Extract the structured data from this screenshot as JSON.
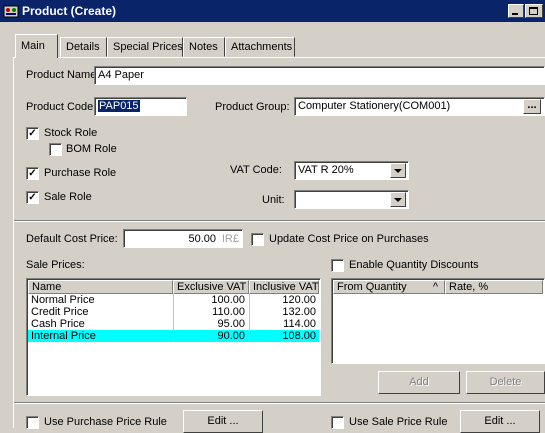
{
  "window": {
    "title": "Product (Create)",
    "icon": "app-icon"
  },
  "tabs": [
    {
      "label": "Main"
    },
    {
      "label": "Details"
    },
    {
      "label": "Special Prices"
    },
    {
      "label": "Notes"
    },
    {
      "label": "Attachments"
    }
  ],
  "form": {
    "product_name_label": "Product Name:",
    "product_name_value": "A4 Paper",
    "product_code_label": "Product Code:",
    "product_code_value": "PAP015",
    "product_group_label": "Product Group:",
    "product_group_value": "Computer Stationery(COM001)",
    "product_group_btn": "...",
    "stock_role_label": "Stock Role",
    "stock_role_checked": true,
    "bom_role_label": "BOM Role",
    "bom_role_checked": false,
    "purchase_role_label": "Purchase Role",
    "purchase_role_checked": true,
    "sale_role_label": "Sale Role",
    "sale_role_checked": true,
    "vat_code_label": "VAT Code:",
    "vat_code_value": "VAT R 20%",
    "unit_label": "Unit:",
    "unit_value": "",
    "default_cost_label": "Default Cost Price:",
    "default_cost_value": "50.00",
    "default_cost_suffix": "IR£",
    "update_cost_label": "Update Cost Price on Purchases",
    "update_cost_checked": false,
    "sale_prices_label": "Sale Prices:",
    "enable_qty_label": "Enable Quantity Discounts",
    "enable_qty_checked": false
  },
  "sale_prices": {
    "columns": [
      "Name",
      "Exclusive VAT",
      "Inclusive VAT"
    ],
    "rows": [
      {
        "name": "Normal Price",
        "excl": "100.00",
        "incl": "120.00"
      },
      {
        "name": "Credit Price",
        "excl": "110.00",
        "incl": "132.00"
      },
      {
        "name": "Cash Price",
        "excl": "95.00",
        "incl": "114.00"
      },
      {
        "name": "Internal Price",
        "excl": "90.00",
        "incl": "108.00"
      }
    ],
    "selected_color": "#00ffff"
  },
  "qty_discounts": {
    "columns": [
      "From Quantity",
      "Rate, %"
    ],
    "sort_indicator": "^",
    "add_label": "Add",
    "delete_label": "Delete"
  },
  "bottom": {
    "purchase_rule_label": "Use Purchase Price Rule",
    "purchase_rule_checked": false,
    "purchase_edit_label": "Edit ...",
    "sale_rule_label": "Use Sale Price Rule",
    "sale_rule_checked": false,
    "sale_edit_label": "Edit ..."
  },
  "colors": {
    "titlebar": "#0a246a",
    "face": "#d4d0c8",
    "selection": "#0a246a"
  }
}
